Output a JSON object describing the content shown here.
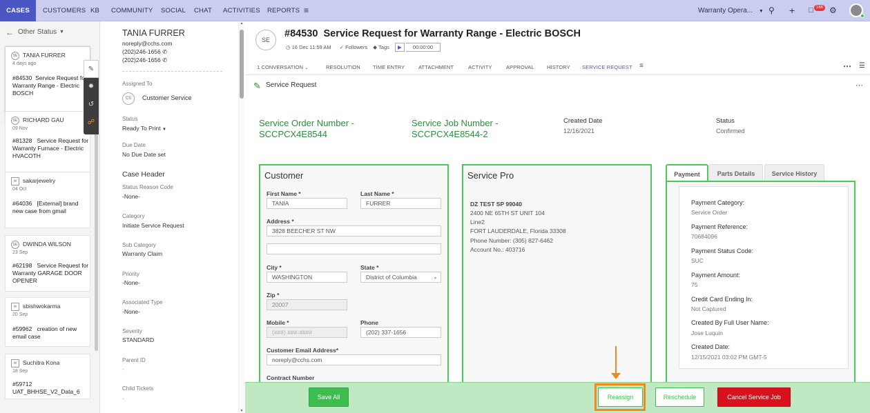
{
  "topnav": {
    "tabs": [
      "Cases",
      "Customers",
      "KB",
      "Community",
      "Social",
      "Chat",
      "Activities",
      "Reports"
    ],
    "workspace_label": "Warranty Opera...",
    "notification_count": "166"
  },
  "list_panel": {
    "filter_label": "Other Status",
    "cases": [
      {
        "initials": "SE",
        "name": "TANIA FURRER",
        "date": "4 days ago",
        "number": "#84530",
        "subject": "Service Request for Warranty Range - Electric BOSCH"
      },
      {
        "initials": "SE",
        "name": "RICHARD GAU",
        "date": "09 Nov",
        "number": "#81328",
        "subject": "Service Request for Warranty Furnace - Electric HVACOTH"
      },
      {
        "initials": "",
        "name": "sakarjewelry",
        "date": "04 Oct",
        "number": "#64036",
        "subject": "[External] brand new case from gmail"
      },
      {
        "initials": "SE",
        "name": "DWINDA WILSON",
        "date": "23 Sep",
        "number": "#62198",
        "subject": "Service Request for Warranty GARAGE DOOR OPENER"
      },
      {
        "initials": "",
        "name": "sbishwokarma",
        "date": "20 Sep",
        "number": "#59962",
        "subject": "creation of new email case"
      },
      {
        "initials": "",
        "name": "Suchitra Kona",
        "date": "18 Sep",
        "number": "#59712",
        "subject": "UAT_BHHSE_V2_Data_6"
      }
    ]
  },
  "detail": {
    "contact_name": "TANIA FURRER",
    "email": "noreply@cchs.com",
    "phone1": "(202)246-1656",
    "phone2": "(202)246-1656",
    "assigned_to_label": "Assigned To",
    "assigned_initials": "CS",
    "assigned_to": "Customer Service",
    "status_label": "Status",
    "status": "Ready To Print",
    "due_date_label": "Due Date",
    "due_date": "No Due Date set",
    "case_header": "Case Header",
    "status_reason_label": "Status Reason Code",
    "status_reason": "-None-",
    "category_label": "Category",
    "category": "Initiate Service Request",
    "sub_category_label": "Sub Category",
    "sub_category": "Warranty Claim",
    "priority_label": "Priority",
    "priority": "-None-",
    "associated_type_label": "Associated Type",
    "associated_type": "-None-",
    "severity_label": "Severity",
    "severity": "STANDARD",
    "parent_id_label": "Parent ID",
    "parent_id": "-",
    "child_tickets_label": "Child Tickets",
    "child_tickets": "-"
  },
  "main": {
    "avatar_initials": "SE",
    "case_number": "#84530",
    "case_title": "Service Request for Warranty Range - Electric BOSCH",
    "created": "16 Dec 11:59 AM",
    "followers": "Followers",
    "tags": "Tags",
    "timer": "00:00:00",
    "tabs": [
      "1 CONVERSATION",
      "RESOLUTION",
      "TIME ENTRY",
      "ATTACHMENT",
      "ACTIVITY",
      "APPROVAL",
      "HISTORY",
      "SERVICE REQUEST"
    ],
    "active_tab_index": 7,
    "section_title": "Service Request"
  },
  "service_request": {
    "order_number": "Service Order Number - SCCPCX4E8544",
    "job_number": "Service Job Number - SCCPCX4E8544-2",
    "created_date_label": "Created Date",
    "created_date": "12/16/2021",
    "status_label": "Status",
    "status": "Confirmed",
    "customer": {
      "title": "Customer",
      "first_name_label": "First Name *",
      "first_name": "TANIA",
      "last_name_label": "Last Name *",
      "last_name": "FURRER",
      "address_label": "Address *",
      "address1": "3828 BEECHER ST NW",
      "address2": "",
      "city_label": "City *",
      "city": "WASHINGTON",
      "state_label": "State *",
      "state": "District of Columbia",
      "zip_label": "Zip *",
      "zip": "20007",
      "mobile_label": "Mobile *",
      "mobile_placeholder": "(###) ###-####",
      "phone_label": "Phone",
      "phone": "(202) 337-1656",
      "email_label": "Customer Email Address*",
      "email": "noreply@cchs.com",
      "contract_label": "Contract Number"
    },
    "service_pro": {
      "title": "Service Pro",
      "name": "DZ TEST SP 99040",
      "address1": "2400 NE 65TH ST UNIT 104",
      "address2": "Line2",
      "city_state": "FORT LAUDERDALE, Florida 33308",
      "phone": "Phone Number: (305) 827-6462",
      "account": "Account No.: 403716"
    },
    "payment_tabs": [
      "Payment",
      "Parts Details",
      "Service History"
    ],
    "payment": [
      {
        "label": "Payment Category:",
        "value": "Service Order"
      },
      {
        "label": "Payment Reference:",
        "value": "70684096"
      },
      {
        "label": "Payment Status Code:",
        "value": "SUC"
      },
      {
        "label": "Payment Amount:",
        "value": "75"
      },
      {
        "label": "Credit Card Ending In:",
        "value": "Not Captured"
      },
      {
        "label": "Created By Full User Name:",
        "value": "Jose Luquin"
      },
      {
        "label": "Created Date:",
        "value": "12/15/2021 03:02 PM GMT-5"
      }
    ]
  },
  "actions": {
    "save_all": "Save All",
    "reassign": "Reassign",
    "reschedule": "Reschedule",
    "cancel_job": "Cancel Service Job"
  },
  "colors": {
    "nav_bg": "#c9cdf0",
    "nav_active": "#4a56c4",
    "accent_green": "#3dbd50",
    "danger": "#d9111c",
    "highlight": "#f08a1e"
  }
}
